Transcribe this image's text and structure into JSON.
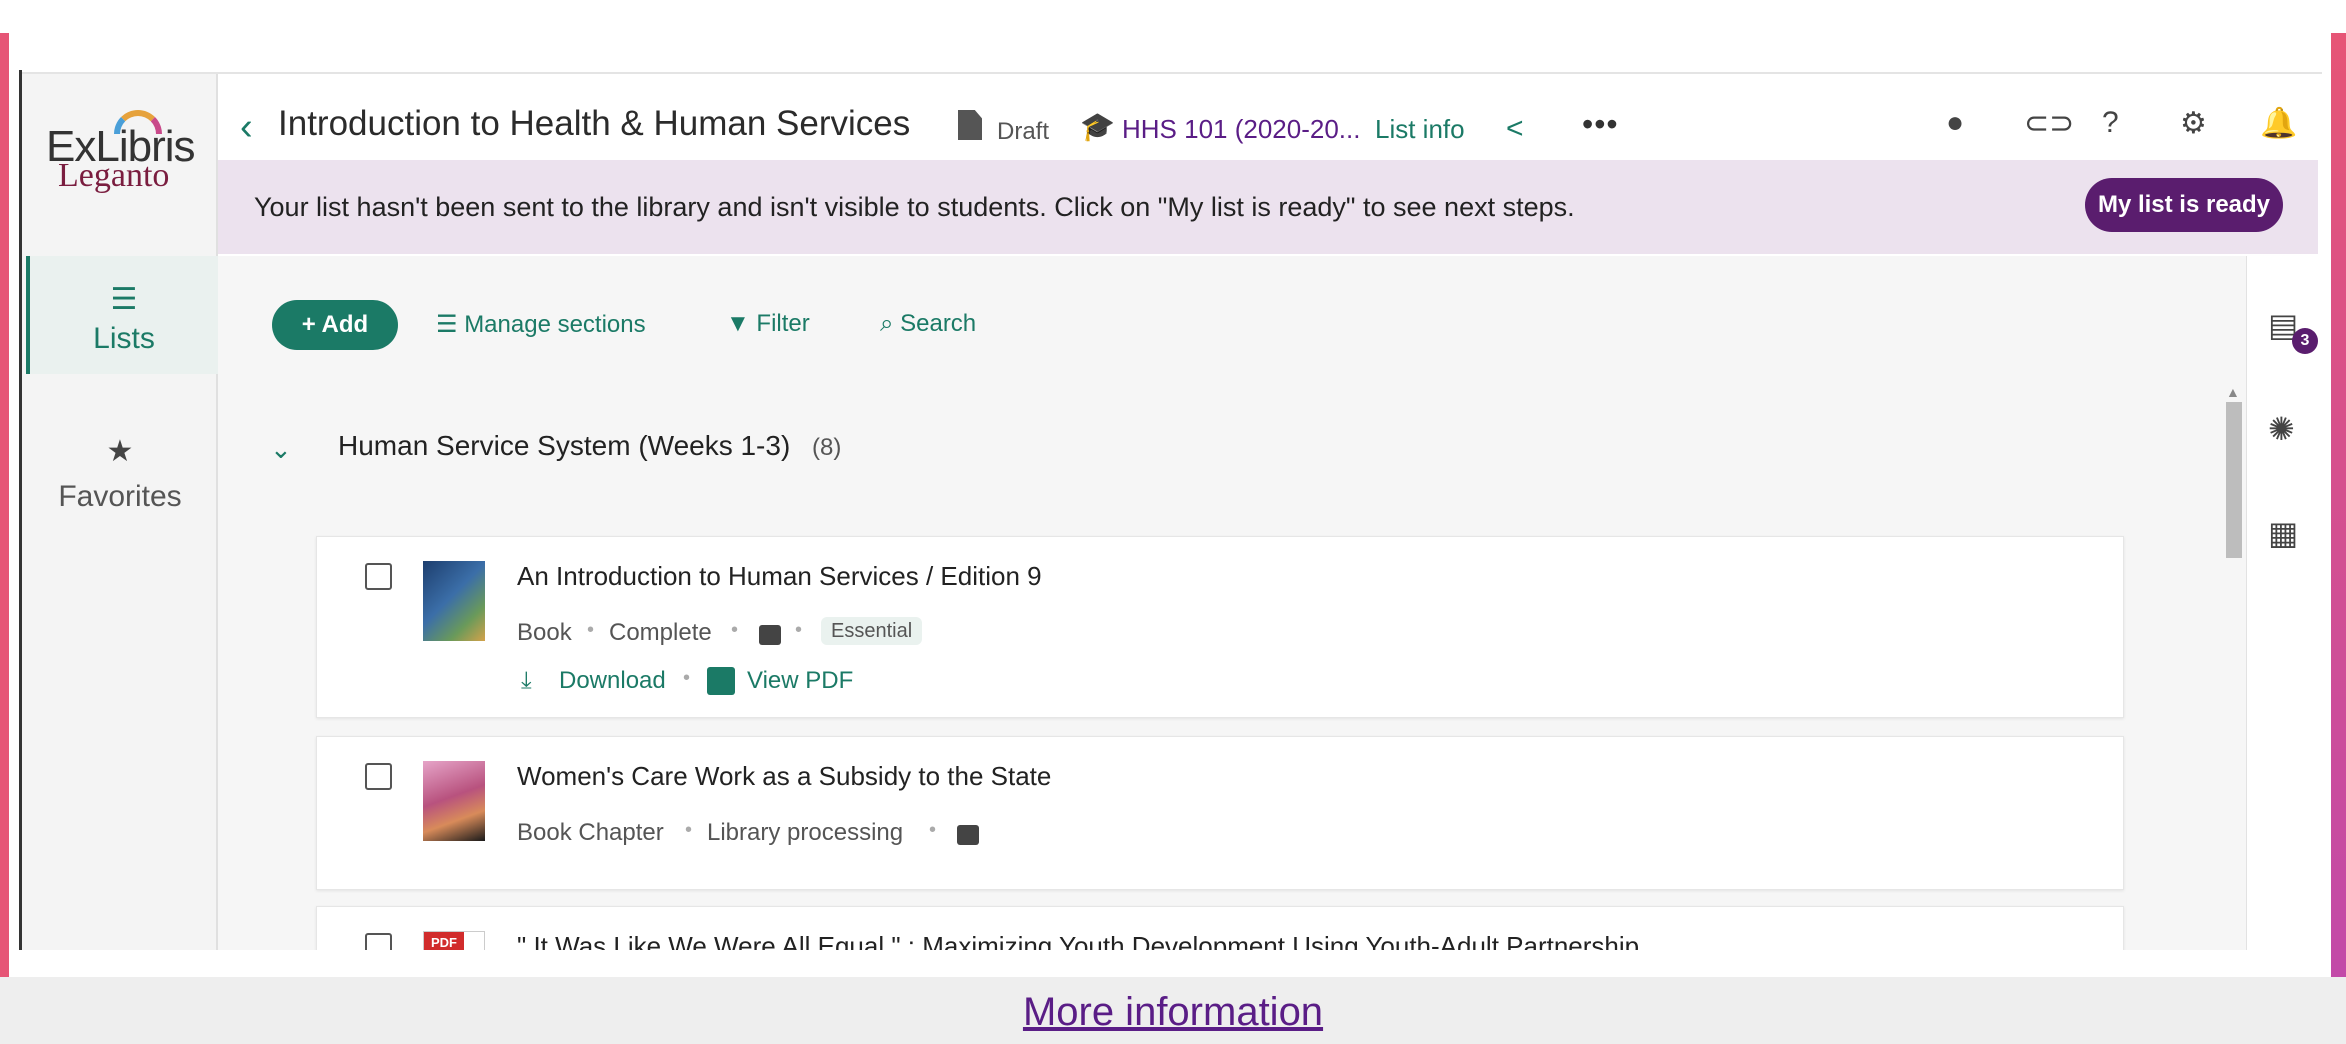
{
  "app": {
    "logo_top": "ExLibris",
    "logo_bottom": "Leganto"
  },
  "sidebar": {
    "items": [
      {
        "label": "Lists",
        "icon": "list-icon",
        "active": true
      },
      {
        "label": "Favorites",
        "icon": "star-icon",
        "active": false
      }
    ]
  },
  "header": {
    "title": "Introduction to Health & Human Services",
    "status": "Draft",
    "course": "HHS 101 (2020-20...",
    "list_info": "List info",
    "icons": [
      "person-icon",
      "link-icon",
      "help-icon",
      "gear-icon",
      "bell-icon"
    ]
  },
  "banner": {
    "text": "Your list hasn't been sent to the library and isn't visible to students. Click on \"My list is ready\" to see next steps.",
    "button": "My list is ready"
  },
  "toolbar": {
    "add": "+ Add",
    "manage_sections": "Manage sections",
    "filter": "Filter",
    "search": "Search"
  },
  "section": {
    "title": "Human Service System (Weeks 1-3)",
    "count": "(8)"
  },
  "items": [
    {
      "title": "An Introduction to Human Services / Edition 9",
      "type": "Book",
      "status": "Complete",
      "tag": "Essential",
      "download": "Download",
      "view_pdf": "View PDF"
    },
    {
      "title": "Women's Care Work as a Subsidy to the State",
      "type": "Book Chapter",
      "status": "Library processing"
    },
    {
      "title": "\" It Was Like We Were All Equal \" : Maximizing Youth Development Using Youth-Adult Partnership",
      "thumb_label": "PDF"
    }
  ],
  "right_rail": {
    "comment_count": "3",
    "icons": [
      "comment-icon",
      "lightbulb-icon",
      "calendar-icon"
    ]
  },
  "footer": {
    "more_info": "More information"
  },
  "colors": {
    "accent": "#1b7a66",
    "purple": "#5a1d6e",
    "banner_bg": "#ece2ee"
  }
}
